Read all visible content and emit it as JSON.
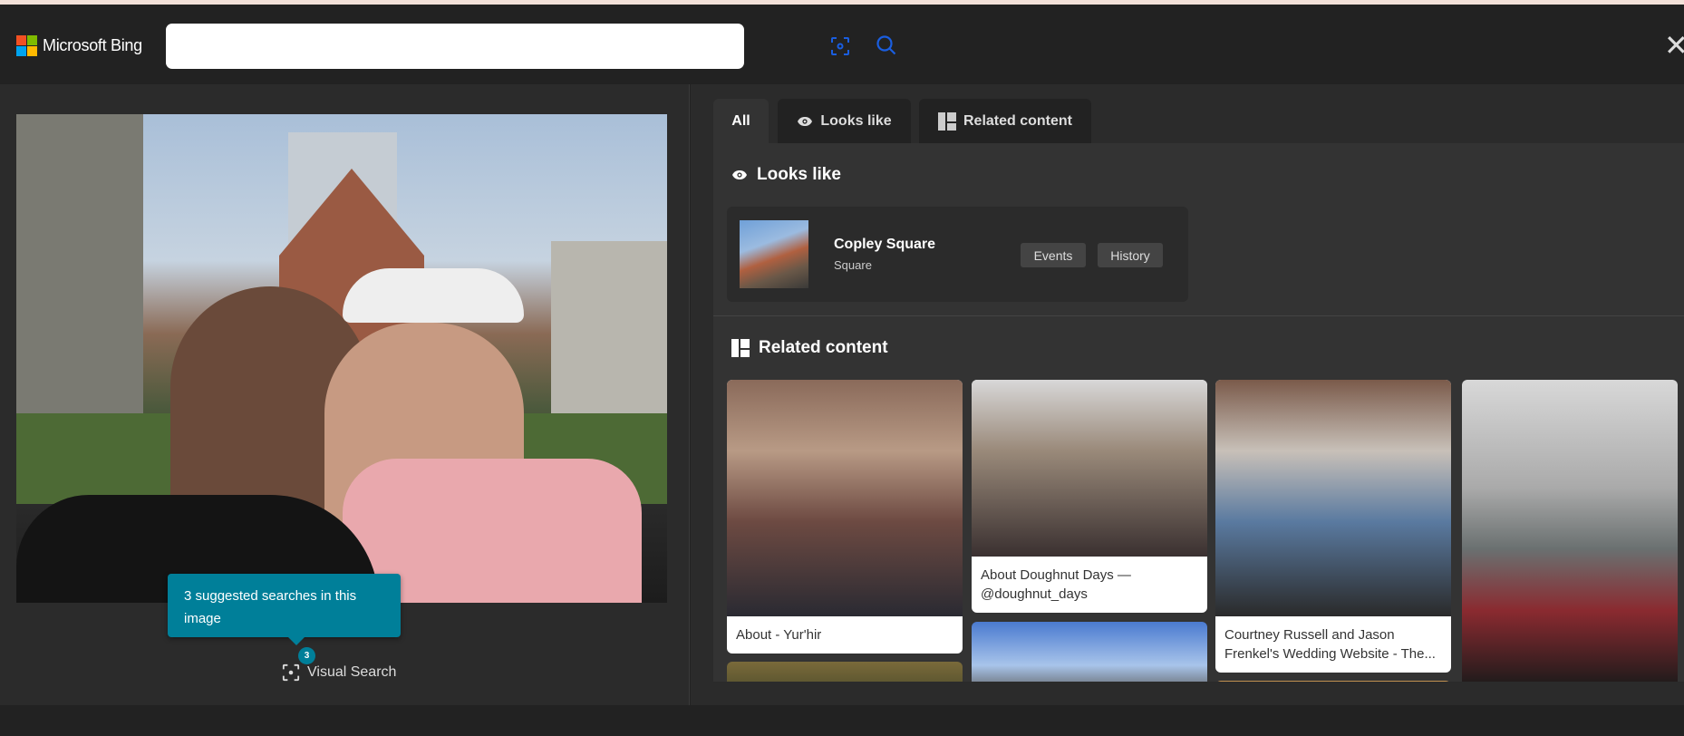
{
  "header": {
    "logo_text": "Microsoft Bing",
    "search": {
      "value": "",
      "placeholder": ""
    },
    "brand_colors": [
      "#f25022",
      "#7fba00",
      "#00a4ef",
      "#ffb900"
    ]
  },
  "left": {
    "tooltip": "3 suggested searches in this image",
    "badge_count": "3",
    "visual_search_label": "Visual Search"
  },
  "tabs": [
    {
      "label": "All",
      "active": true
    },
    {
      "label": "Looks like",
      "icon": "eye-icon"
    },
    {
      "label": "Related content",
      "icon": "grid-icon"
    }
  ],
  "looks_like": {
    "heading": "Looks like",
    "entity": {
      "name": "Copley Square",
      "type": "Square",
      "chips": [
        "Events",
        "History"
      ]
    }
  },
  "related": {
    "heading": "Related content",
    "cards": [
      {
        "caption": "About - Yur'hir"
      },
      {
        "caption": "About Doughnut Days — @doughnut_days"
      },
      {
        "caption": "Courtney Russell and Jason Frenkel's Wedding Website - The..."
      },
      {
        "caption": ""
      }
    ]
  },
  "colors": {
    "accent": "#007f99",
    "background": "#2b2b2b"
  }
}
